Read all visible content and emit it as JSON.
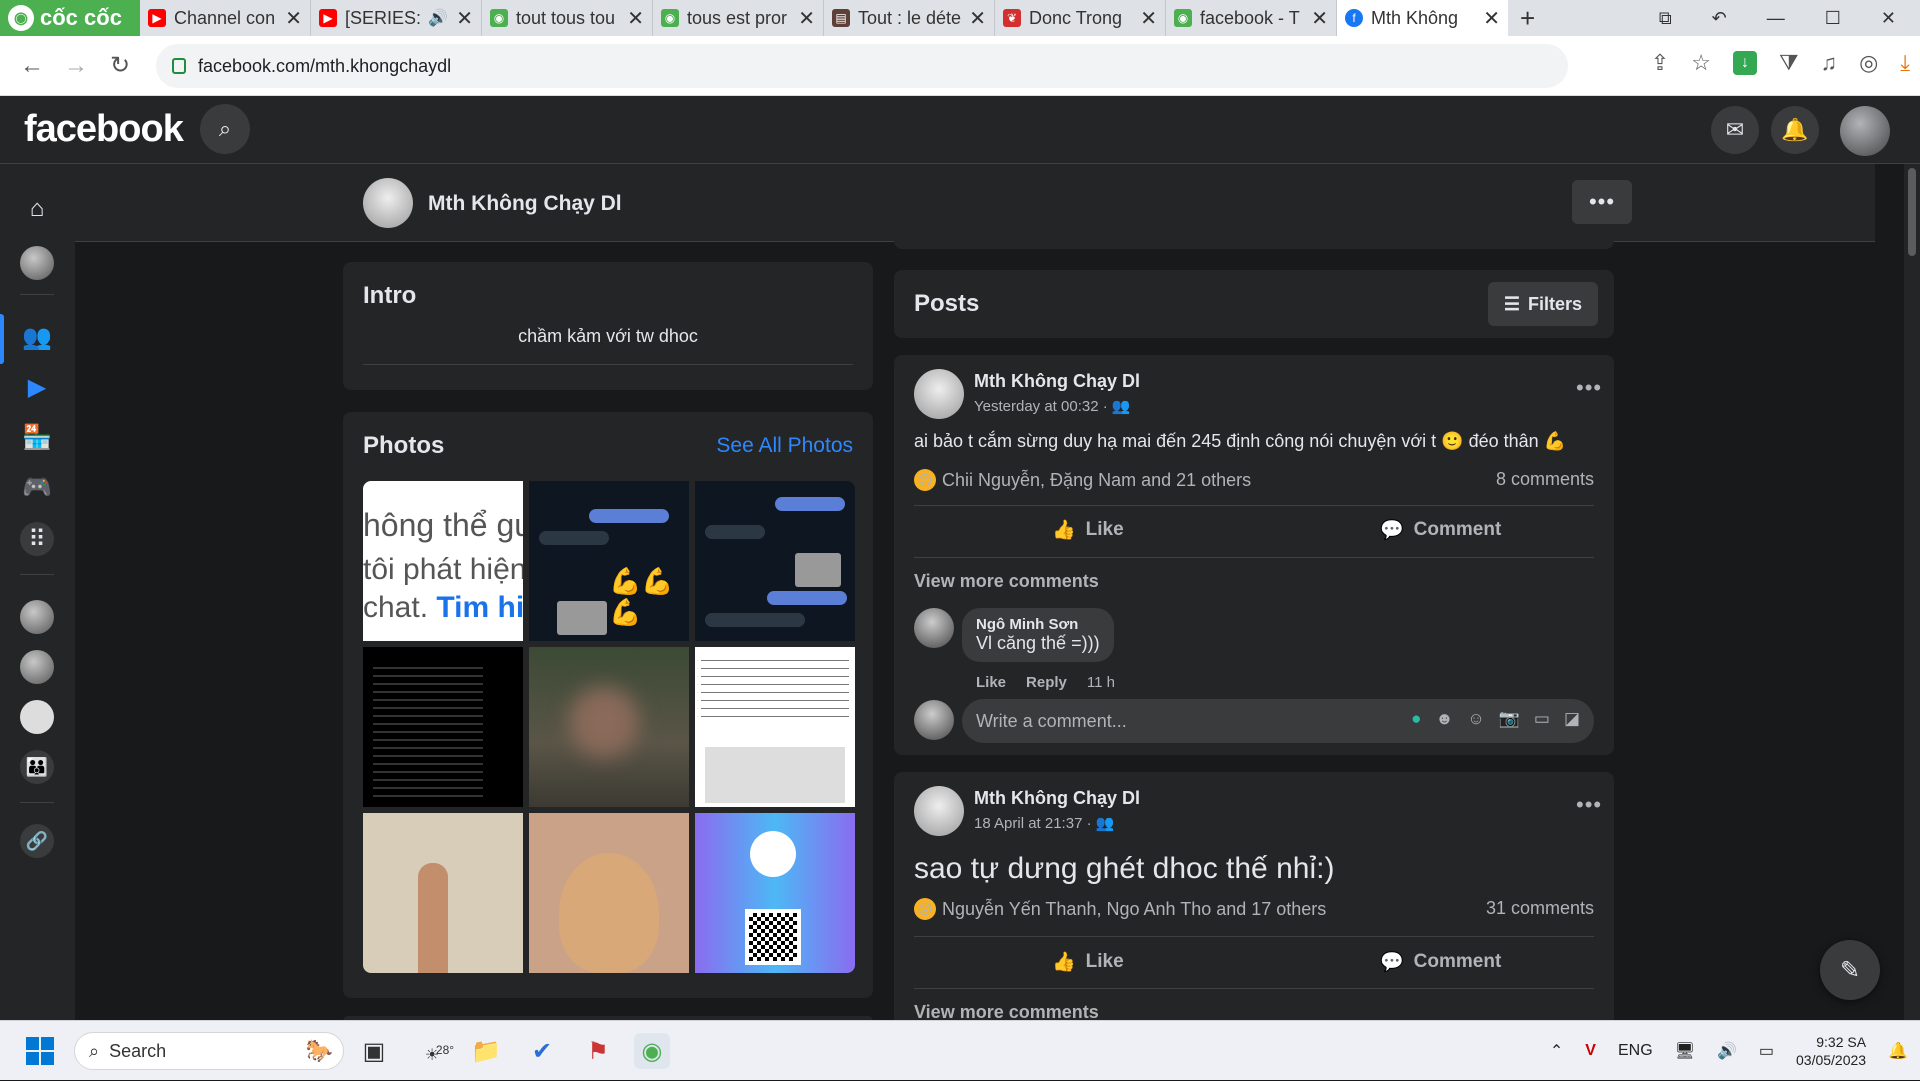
{
  "browser": {
    "brand": "cốc cốc",
    "tabs": [
      {
        "title": "Channel con",
        "favicon_color": "#ff0000",
        "favicon": "youtube-icon"
      },
      {
        "title": "[SERIES: I",
        "favicon_color": "#ff0000",
        "favicon": "youtube-icon"
      },
      {
        "title": "tout tous tou",
        "favicon_color": "#4caf50",
        "favicon": "coccoc-icon"
      },
      {
        "title": "tous est pror",
        "favicon_color": "#4caf50",
        "favicon": "coccoc-icon"
      },
      {
        "title": "Tout : le déte",
        "favicon_color": "#5d4037",
        "favicon": "clapper-icon"
      },
      {
        "title": "Donc Trong",
        "favicon_color": "#d32f2f",
        "favicon": "leaf-icon"
      },
      {
        "title": "facebook - T",
        "favicon_color": "#4caf50",
        "favicon": "coccoc-icon"
      },
      {
        "title": "Mth Không",
        "favicon_color": "#1877f2",
        "favicon": "facebook-icon",
        "active": true
      }
    ],
    "url": "facebook.com/mth.khongchaydl"
  },
  "fb": {
    "logo": "facebook",
    "accent": "#2d88ff"
  },
  "profile": {
    "name": "Mth Không Chạy Dl",
    "more": "•••"
  },
  "intro": {
    "title": "Intro",
    "bio": "chầm kảm với tw dhoc"
  },
  "photos": {
    "title": "Photos",
    "see_all": "See All Photos",
    "tile1_line1": "hông thể gu",
    "tile1_line2": "tôi phát hiện",
    "tile1_line3a": "chat. ",
    "tile1_line3b": "Tim hi"
  },
  "posts_header": {
    "title": "Posts",
    "filters": "Filters"
  },
  "posts": [
    {
      "author": "Mth Không Chạy Dl",
      "time": "Yesterday at 00:32 ·",
      "text": "ai bảo t cắm sừng duy hạ mai đến 245 định công nói chuyện với t 🙂 đéo thân 💪",
      "reactions": "Chii Nguyễn, Đặng Nam and 21 others",
      "comments": "8 comments",
      "like": "Like",
      "comment": "Comment",
      "view_more": "View more comments",
      "top_comment": {
        "name": "Ngô Minh Sơn",
        "text": "Vl căng thế =)))",
        "like": "Like",
        "reply": "Reply",
        "time": "11 h"
      },
      "write_placeholder": "Write a comment..."
    },
    {
      "author": "Mth Không Chạy Dl",
      "time": "18 April at 21:37 ·",
      "text": "sao tự dưng ghét dhoc thế nhỉ:)",
      "reactions": "Nguyễn Yến Thanh, Ngo Anh Tho and 17 others",
      "comments": "31 comments",
      "like": "Like",
      "comment": "Comment",
      "view_more": "View more comments"
    }
  ],
  "taskbar": {
    "search": "Search",
    "weather": "28°",
    "lang": "ENG",
    "time": "9:32 SA",
    "date": "03/05/2023"
  }
}
